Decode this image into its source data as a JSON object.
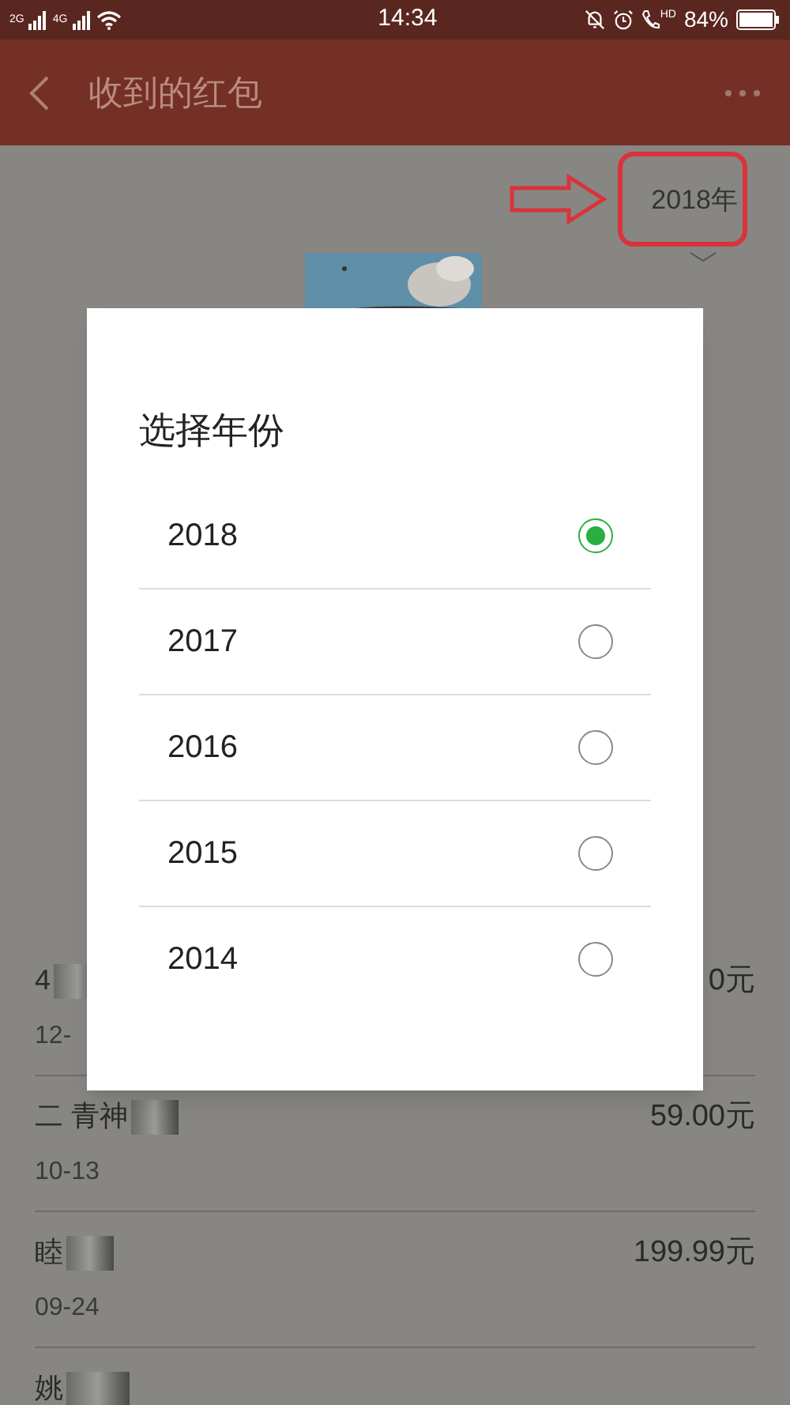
{
  "status_bar": {
    "network_1": "2G",
    "network_2": "4G",
    "time": "14:34",
    "call_label": "HD",
    "battery": "84%"
  },
  "header": {
    "title": "收到的红包"
  },
  "year_selector": {
    "label": "2018年"
  },
  "records": [
    {
      "name": "4",
      "date": "12-",
      "amount": "0元"
    },
    {
      "name": "二 青神",
      "date": "10-13",
      "amount": "59.00元"
    },
    {
      "name": "睦",
      "date": "09-24",
      "amount": "199.99元"
    },
    {
      "name": "姚"
    }
  ],
  "dialog": {
    "title": "选择年份",
    "options": [
      {
        "label": "2018",
        "selected": true
      },
      {
        "label": "2017",
        "selected": false
      },
      {
        "label": "2016",
        "selected": false
      },
      {
        "label": "2015",
        "selected": false
      },
      {
        "label": "2014",
        "selected": false
      }
    ]
  }
}
